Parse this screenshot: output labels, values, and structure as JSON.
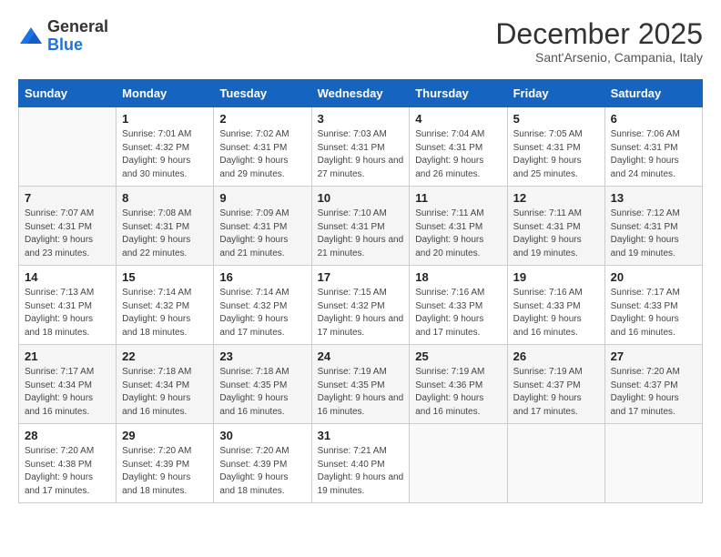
{
  "logo": {
    "general": "General",
    "blue": "Blue"
  },
  "title": "December 2025",
  "subtitle": "Sant'Arsenio, Campania, Italy",
  "weekdays": [
    "Sunday",
    "Monday",
    "Tuesday",
    "Wednesday",
    "Thursday",
    "Friday",
    "Saturday"
  ],
  "weeks": [
    [
      {
        "day": "",
        "sunrise": "",
        "sunset": "",
        "daylight": ""
      },
      {
        "day": "1",
        "sunrise": "Sunrise: 7:01 AM",
        "sunset": "Sunset: 4:32 PM",
        "daylight": "Daylight: 9 hours and 30 minutes."
      },
      {
        "day": "2",
        "sunrise": "Sunrise: 7:02 AM",
        "sunset": "Sunset: 4:31 PM",
        "daylight": "Daylight: 9 hours and 29 minutes."
      },
      {
        "day": "3",
        "sunrise": "Sunrise: 7:03 AM",
        "sunset": "Sunset: 4:31 PM",
        "daylight": "Daylight: 9 hours and 27 minutes."
      },
      {
        "day": "4",
        "sunrise": "Sunrise: 7:04 AM",
        "sunset": "Sunset: 4:31 PM",
        "daylight": "Daylight: 9 hours and 26 minutes."
      },
      {
        "day": "5",
        "sunrise": "Sunrise: 7:05 AM",
        "sunset": "Sunset: 4:31 PM",
        "daylight": "Daylight: 9 hours and 25 minutes."
      },
      {
        "day": "6",
        "sunrise": "Sunrise: 7:06 AM",
        "sunset": "Sunset: 4:31 PM",
        "daylight": "Daylight: 9 hours and 24 minutes."
      }
    ],
    [
      {
        "day": "7",
        "sunrise": "Sunrise: 7:07 AM",
        "sunset": "Sunset: 4:31 PM",
        "daylight": "Daylight: 9 hours and 23 minutes."
      },
      {
        "day": "8",
        "sunrise": "Sunrise: 7:08 AM",
        "sunset": "Sunset: 4:31 PM",
        "daylight": "Daylight: 9 hours and 22 minutes."
      },
      {
        "day": "9",
        "sunrise": "Sunrise: 7:09 AM",
        "sunset": "Sunset: 4:31 PM",
        "daylight": "Daylight: 9 hours and 21 minutes."
      },
      {
        "day": "10",
        "sunrise": "Sunrise: 7:10 AM",
        "sunset": "Sunset: 4:31 PM",
        "daylight": "Daylight: 9 hours and 21 minutes."
      },
      {
        "day": "11",
        "sunrise": "Sunrise: 7:11 AM",
        "sunset": "Sunset: 4:31 PM",
        "daylight": "Daylight: 9 hours and 20 minutes."
      },
      {
        "day": "12",
        "sunrise": "Sunrise: 7:11 AM",
        "sunset": "Sunset: 4:31 PM",
        "daylight": "Daylight: 9 hours and 19 minutes."
      },
      {
        "day": "13",
        "sunrise": "Sunrise: 7:12 AM",
        "sunset": "Sunset: 4:31 PM",
        "daylight": "Daylight: 9 hours and 19 minutes."
      }
    ],
    [
      {
        "day": "14",
        "sunrise": "Sunrise: 7:13 AM",
        "sunset": "Sunset: 4:31 PM",
        "daylight": "Daylight: 9 hours and 18 minutes."
      },
      {
        "day": "15",
        "sunrise": "Sunrise: 7:14 AM",
        "sunset": "Sunset: 4:32 PM",
        "daylight": "Daylight: 9 hours and 18 minutes."
      },
      {
        "day": "16",
        "sunrise": "Sunrise: 7:14 AM",
        "sunset": "Sunset: 4:32 PM",
        "daylight": "Daylight: 9 hours and 17 minutes."
      },
      {
        "day": "17",
        "sunrise": "Sunrise: 7:15 AM",
        "sunset": "Sunset: 4:32 PM",
        "daylight": "Daylight: 9 hours and 17 minutes."
      },
      {
        "day": "18",
        "sunrise": "Sunrise: 7:16 AM",
        "sunset": "Sunset: 4:33 PM",
        "daylight": "Daylight: 9 hours and 17 minutes."
      },
      {
        "day": "19",
        "sunrise": "Sunrise: 7:16 AM",
        "sunset": "Sunset: 4:33 PM",
        "daylight": "Daylight: 9 hours and 16 minutes."
      },
      {
        "day": "20",
        "sunrise": "Sunrise: 7:17 AM",
        "sunset": "Sunset: 4:33 PM",
        "daylight": "Daylight: 9 hours and 16 minutes."
      }
    ],
    [
      {
        "day": "21",
        "sunrise": "Sunrise: 7:17 AM",
        "sunset": "Sunset: 4:34 PM",
        "daylight": "Daylight: 9 hours and 16 minutes."
      },
      {
        "day": "22",
        "sunrise": "Sunrise: 7:18 AM",
        "sunset": "Sunset: 4:34 PM",
        "daylight": "Daylight: 9 hours and 16 minutes."
      },
      {
        "day": "23",
        "sunrise": "Sunrise: 7:18 AM",
        "sunset": "Sunset: 4:35 PM",
        "daylight": "Daylight: 9 hours and 16 minutes."
      },
      {
        "day": "24",
        "sunrise": "Sunrise: 7:19 AM",
        "sunset": "Sunset: 4:35 PM",
        "daylight": "Daylight: 9 hours and 16 minutes."
      },
      {
        "day": "25",
        "sunrise": "Sunrise: 7:19 AM",
        "sunset": "Sunset: 4:36 PM",
        "daylight": "Daylight: 9 hours and 16 minutes."
      },
      {
        "day": "26",
        "sunrise": "Sunrise: 7:19 AM",
        "sunset": "Sunset: 4:37 PM",
        "daylight": "Daylight: 9 hours and 17 minutes."
      },
      {
        "day": "27",
        "sunrise": "Sunrise: 7:20 AM",
        "sunset": "Sunset: 4:37 PM",
        "daylight": "Daylight: 9 hours and 17 minutes."
      }
    ],
    [
      {
        "day": "28",
        "sunrise": "Sunrise: 7:20 AM",
        "sunset": "Sunset: 4:38 PM",
        "daylight": "Daylight: 9 hours and 17 minutes."
      },
      {
        "day": "29",
        "sunrise": "Sunrise: 7:20 AM",
        "sunset": "Sunset: 4:39 PM",
        "daylight": "Daylight: 9 hours and 18 minutes."
      },
      {
        "day": "30",
        "sunrise": "Sunrise: 7:20 AM",
        "sunset": "Sunset: 4:39 PM",
        "daylight": "Daylight: 9 hours and 18 minutes."
      },
      {
        "day": "31",
        "sunrise": "Sunrise: 7:21 AM",
        "sunset": "Sunset: 4:40 PM",
        "daylight": "Daylight: 9 hours and 19 minutes."
      },
      {
        "day": "",
        "sunrise": "",
        "sunset": "",
        "daylight": ""
      },
      {
        "day": "",
        "sunrise": "",
        "sunset": "",
        "daylight": ""
      },
      {
        "day": "",
        "sunrise": "",
        "sunset": "",
        "daylight": ""
      }
    ]
  ]
}
